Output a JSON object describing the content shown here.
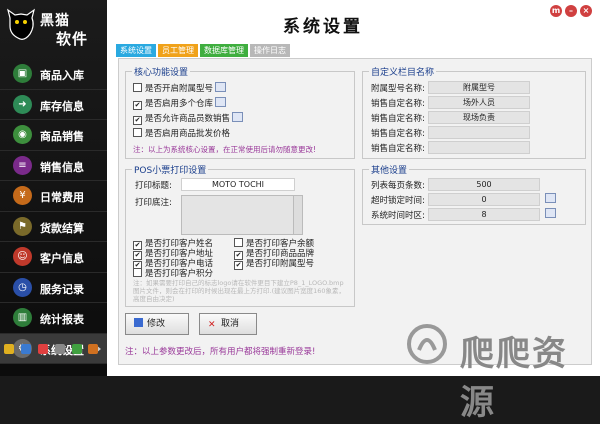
{
  "brand": {
    "line1": "黑猫",
    "line2": "软件"
  },
  "sidebar": {
    "items": [
      {
        "label": "商品入库",
        "icon": "box-in-icon"
      },
      {
        "label": "库存信息",
        "icon": "arrow-right-icon"
      },
      {
        "label": "商品销售",
        "icon": "cart-icon"
      },
      {
        "label": "销售信息",
        "icon": "list-icon"
      },
      {
        "label": "日常费用",
        "icon": "coin-icon"
      },
      {
        "label": "货款结算",
        "icon": "flag-icon"
      },
      {
        "label": "客户信息",
        "icon": "user-icon"
      },
      {
        "label": "服务记录",
        "icon": "clock-icon"
      },
      {
        "label": "统计报表",
        "icon": "chart-icon"
      },
      {
        "label": "系统设置",
        "icon": "gear-icon",
        "active": true
      }
    ]
  },
  "window": {
    "title": "系统设置"
  },
  "tabs": [
    {
      "label": "系统设置",
      "color": "#2aa9e0"
    },
    {
      "label": "员工管理",
      "color": "#f0a21a"
    },
    {
      "label": "数据库管理",
      "color": "#3fae3f"
    },
    {
      "label": "操作日志",
      "color": "#b8b8b8"
    }
  ],
  "core": {
    "legend": "核心功能设置",
    "options": [
      {
        "label": "是否开启附属型号",
        "checked": false
      },
      {
        "label": "是否启用多个仓库",
        "checked": true
      },
      {
        "label": "是否允许商品员数销售",
        "checked": true
      },
      {
        "label": "是否启用商品批发价格",
        "checked": false
      }
    ],
    "note": "注：以上为系统核心设置，在正常使用后请勿随意更改!"
  },
  "custom": {
    "legend": "自定义栏目名称",
    "rows": [
      {
        "label": "附属型号名称:",
        "value": "附属型号"
      },
      {
        "label": "销售自定名称:",
        "value": "场外人员"
      },
      {
        "label": "销售自定名称:",
        "value": "现场负责"
      },
      {
        "label": "销售自定名称:",
        "value": ""
      },
      {
        "label": "销售自定名称:",
        "value": ""
      }
    ]
  },
  "pos": {
    "legend": "POS小票打印设置",
    "title_label": "打印标题:",
    "title_value": "MOTO TOCHI",
    "footer_label": "打印底注:",
    "options_left": [
      {
        "label": "是否打印客户姓名",
        "checked": true
      },
      {
        "label": "是否打印客户地址",
        "checked": true
      },
      {
        "label": "是否打印客户电话",
        "checked": true
      },
      {
        "label": "是否打印客户积分",
        "checked": false
      }
    ],
    "options_right": [
      {
        "label": "是否打印客户余额",
        "checked": false
      },
      {
        "label": "是否打印商品品牌",
        "checked": true
      },
      {
        "label": "是否打印附属型号",
        "checked": true
      }
    ],
    "note": "注：如果需要打印自己的标志logo请在软件更目下建立P8_1_LOGO.bmp图片文件，则会在打印的时候出现在最上方打印.(建议图片宽度160象素，高度自由决定)"
  },
  "other": {
    "legend": "其他设置",
    "rows": [
      {
        "label": "列表每页条数:",
        "value": "500"
      },
      {
        "label": "超时锁定时间:",
        "value": "0"
      },
      {
        "label": "系统时间时区:",
        "value": "8"
      }
    ]
  },
  "buttons": {
    "save": "修改",
    "cancel": "取消"
  },
  "footnote": "注：以上参数更改后，所有用户都将强制重新登录!",
  "watermark": "爬爬资源"
}
